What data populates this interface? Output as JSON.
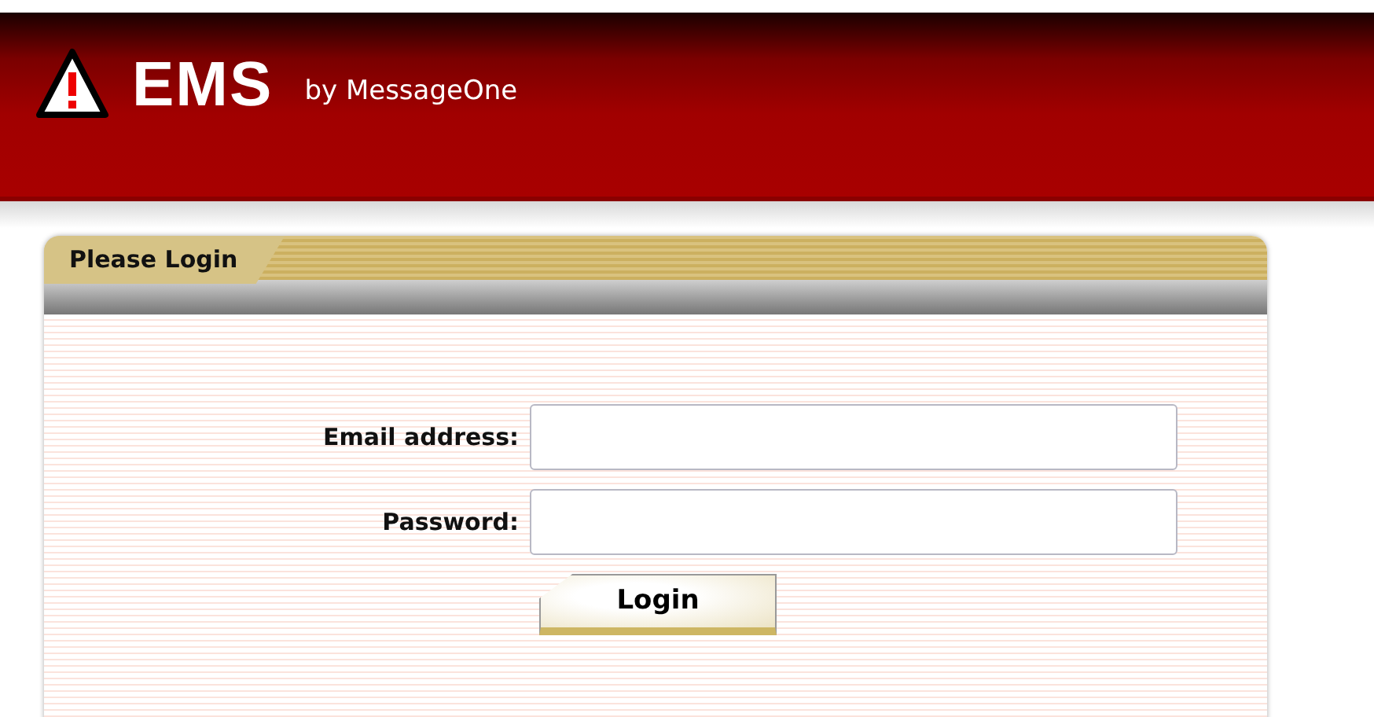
{
  "header": {
    "logo": "EMS",
    "tagline": "by MessageOne"
  },
  "login_panel": {
    "title": "Please Login",
    "fields": [
      {
        "label": "Email address:"
      },
      {
        "label": "Password:"
      }
    ],
    "button": "Login"
  }
}
